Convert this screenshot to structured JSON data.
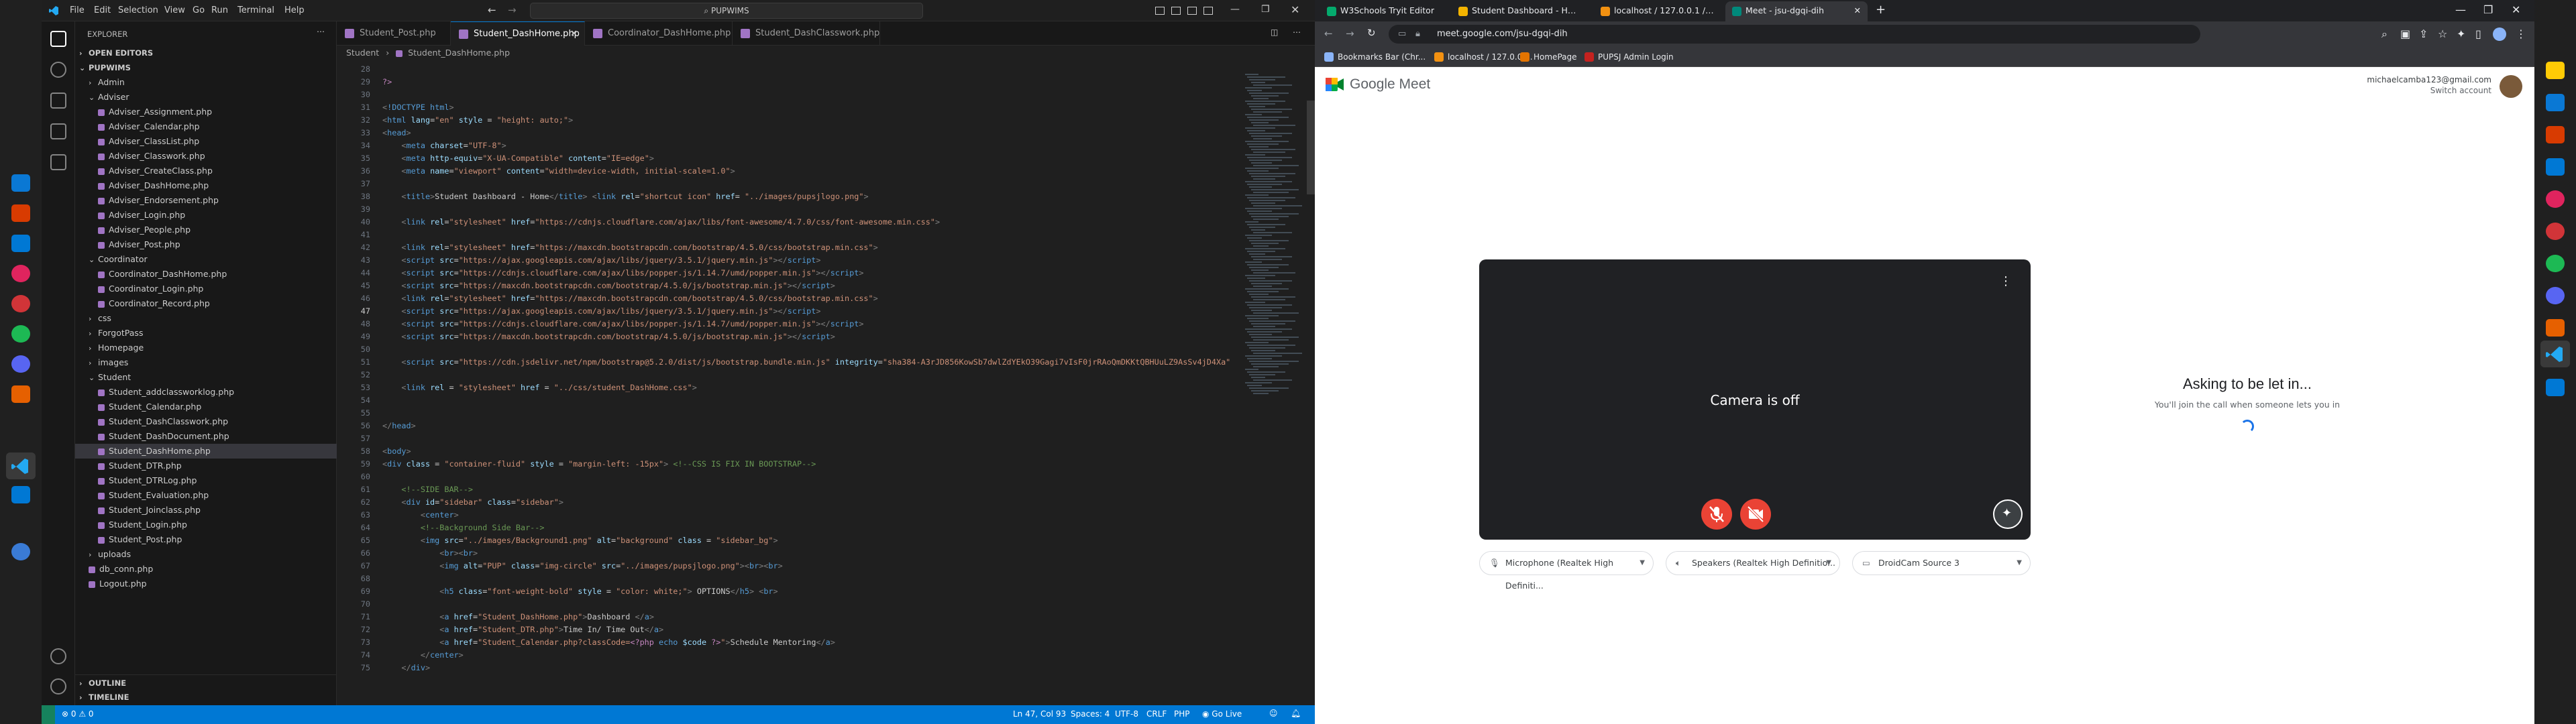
{
  "vscode": {
    "menu": [
      "File",
      "Edit",
      "Selection",
      "View",
      "Go",
      "Run",
      "Terminal",
      "Help"
    ],
    "search": "PUPWIMS",
    "explorer": {
      "title": "EXPLORER",
      "open_editors": "OPEN EDITORS",
      "root": "PUPWIMS",
      "items": [
        {
          "label": "Admin",
          "type": "folder",
          "depth": 1,
          "open": false
        },
        {
          "label": "Adviser",
          "type": "folder",
          "depth": 1,
          "open": true
        },
        {
          "label": "Adviser_Assignment.php",
          "type": "file",
          "depth": 2
        },
        {
          "label": "Adviser_Calendar.php",
          "type": "file",
          "depth": 2
        },
        {
          "label": "Adviser_ClassList.php",
          "type": "file",
          "depth": 2
        },
        {
          "label": "Adviser_Classwork.php",
          "type": "file",
          "depth": 2
        },
        {
          "label": "Adviser_CreateClass.php",
          "type": "file",
          "depth": 2
        },
        {
          "label": "Adviser_DashHome.php",
          "type": "file",
          "depth": 2
        },
        {
          "label": "Adviser_Endorsement.php",
          "type": "file",
          "depth": 2
        },
        {
          "label": "Adviser_Login.php",
          "type": "file",
          "depth": 2
        },
        {
          "label": "Adviser_People.php",
          "type": "file",
          "depth": 2
        },
        {
          "label": "Adviser_Post.php",
          "type": "file",
          "depth": 2
        },
        {
          "label": "Coordinator",
          "type": "folder",
          "depth": 1,
          "open": true
        },
        {
          "label": "Coordinator_DashHome.php",
          "type": "file",
          "depth": 2
        },
        {
          "label": "Coordinator_Login.php",
          "type": "file",
          "depth": 2
        },
        {
          "label": "Coordinator_Record.php",
          "type": "file",
          "depth": 2
        },
        {
          "label": "css",
          "type": "folder",
          "depth": 1,
          "open": false
        },
        {
          "label": "ForgotPass",
          "type": "folder",
          "depth": 1,
          "open": false
        },
        {
          "label": "Homepage",
          "type": "folder",
          "depth": 1,
          "open": false
        },
        {
          "label": "images",
          "type": "folder",
          "depth": 1,
          "open": false
        },
        {
          "label": "Student",
          "type": "folder",
          "depth": 1,
          "open": true
        },
        {
          "label": "Student_addclassworklog.php",
          "type": "file",
          "depth": 2
        },
        {
          "label": "Student_Calendar.php",
          "type": "file",
          "depth": 2
        },
        {
          "label": "Student_DashClasswork.php",
          "type": "file",
          "depth": 2
        },
        {
          "label": "Student_DashDocument.php",
          "type": "file",
          "depth": 2
        },
        {
          "label": "Student_DashHome.php",
          "type": "file",
          "depth": 2,
          "selected": true
        },
        {
          "label": "Student_DTR.php",
          "type": "file",
          "depth": 2
        },
        {
          "label": "Student_DTRLog.php",
          "type": "file",
          "depth": 2
        },
        {
          "label": "Student_Evaluation.php",
          "type": "file",
          "depth": 2
        },
        {
          "label": "Student_Joinclass.php",
          "type": "file",
          "depth": 2
        },
        {
          "label": "Student_Login.php",
          "type": "file",
          "depth": 2
        },
        {
          "label": "Student_Post.php",
          "type": "file",
          "depth": 2
        },
        {
          "label": "uploads",
          "type": "folder",
          "depth": 1,
          "open": false
        },
        {
          "label": "db_conn.php",
          "type": "file",
          "depth": 1
        },
        {
          "label": "Logout.php",
          "type": "file",
          "depth": 1
        }
      ],
      "outline": "OUTLINE",
      "timeline": "TIMELINE"
    },
    "tabs": [
      {
        "label": "Student_Post.php",
        "active": false
      },
      {
        "label": "Student_DashHome.php",
        "active": true
      },
      {
        "label": "Coordinator_DashHome.php",
        "active": false
      },
      {
        "label": "Student_DashClasswork.php",
        "active": false
      }
    ],
    "breadcrumb": [
      "Student",
      "Student_DashHome.php"
    ],
    "current_line": "47",
    "code_lines": [
      {
        "n": "28",
        "h": ""
      },
      {
        "n": "29",
        "h": "<span class='k'>?&gt;</span>"
      },
      {
        "n": "30",
        "h": ""
      },
      {
        "n": "31",
        "h": "<span class='p'>&lt;</span><span class='t'>!DOCTYPE html</span><span class='p'>&gt;</span>"
      },
      {
        "n": "32",
        "h": "<span class='p'>&lt;</span><span class='t'>html</span> <span class='a'>lang</span>=<span class='s'>\"en\"</span> <span class='a'>style</span> = <span class='s'>\"height: auto;\"</span><span class='p'>&gt;</span>"
      },
      {
        "n": "33",
        "h": "<span class='p'>&lt;</span><span class='t'>head</span><span class='p'>&gt;</span>"
      },
      {
        "n": "34",
        "h": "    <span class='p'>&lt;</span><span class='t'>meta</span> <span class='a'>charset</span>=<span class='s'>\"UTF-8\"</span><span class='p'>&gt;</span>"
      },
      {
        "n": "35",
        "h": "    <span class='p'>&lt;</span><span class='t'>meta</span> <span class='a'>http-equiv</span>=<span class='s'>\"X-UA-Compatible\"</span> <span class='a'>content</span>=<span class='s'>\"IE=edge\"</span><span class='p'>&gt;</span>"
      },
      {
        "n": "36",
        "h": "    <span class='p'>&lt;</span><span class='t'>meta</span> <span class='a'>name</span>=<span class='s'>\"viewport\"</span> <span class='a'>content</span>=<span class='s'>\"width=device-width, initial-scale=1.0\"</span><span class='p'>&gt;</span>"
      },
      {
        "n": "37",
        "h": ""
      },
      {
        "n": "38",
        "h": "    <span class='p'>&lt;</span><span class='t'>title</span><span class='p'>&gt;</span>Student Dashboard - Home<span class='p'>&lt;/</span><span class='t'>title</span><span class='p'>&gt;</span> <span class='p'>&lt;</span><span class='t'>link</span> <span class='a'>rel</span>=<span class='s'>\"shortcut icon\"</span> <span class='a'>href</span>= <span class='s'>\"../images/pupsjlogo.png\"</span><span class='p'>&gt;</span>"
      },
      {
        "n": "39",
        "h": ""
      },
      {
        "n": "40",
        "h": "    <span class='p'>&lt;</span><span class='t'>link</span> <span class='a'>rel</span>=<span class='s'>\"stylesheet\"</span> <span class='a'>href</span>=<span class='s'>\"https://cdnjs.cloudflare.com/ajax/libs/font-awesome/4.7.0/css/font-awesome.min.css\"</span><span class='p'>&gt;</span>"
      },
      {
        "n": "41",
        "h": ""
      },
      {
        "n": "42",
        "h": "    <span class='p'>&lt;</span><span class='t'>link</span> <span class='a'>rel</span>=<span class='s'>\"stylesheet\"</span> <span class='a'>href</span>=<span class='s'>\"https://maxcdn.bootstrapcdn.com/bootstrap/4.5.0/css/bootstrap.min.css\"</span><span class='p'>&gt;</span>"
      },
      {
        "n": "43",
        "h": "    <span class='p'>&lt;</span><span class='t'>script</span> <span class='a'>src</span>=<span class='s'>\"https://ajax.googleapis.com/ajax/libs/jquery/3.5.1/jquery.min.js\"</span><span class='p'>&gt;&lt;/</span><span class='t'>script</span><span class='p'>&gt;</span>"
      },
      {
        "n": "44",
        "h": "    <span class='p'>&lt;</span><span class='t'>script</span> <span class='a'>src</span>=<span class='s'>\"https://cdnjs.cloudflare.com/ajax/libs/popper.js/1.14.7/umd/popper.min.js\"</span><span class='p'>&gt;&lt;/</span><span class='t'>script</span><span class='p'>&gt;</span>"
      },
      {
        "n": "45",
        "h": "    <span class='p'>&lt;</span><span class='t'>script</span> <span class='a'>src</span>=<span class='s'>\"https://maxcdn.bootstrapcdn.com/bootstrap/4.5.0/js/bootstrap.min.js\"</span><span class='p'>&gt;&lt;/</span><span class='t'>script</span><span class='p'>&gt;</span>"
      },
      {
        "n": "46",
        "h": "    <span class='p'>&lt;</span><span class='t'>link</span> <span class='a'>rel</span>=<span class='s'>\"stylesheet\"</span> <span class='a'>href</span>=<span class='s'>\"https://maxcdn.bootstrapcdn.com/bootstrap/4.5.0/css/bootstrap.min.css\"</span><span class='p'>&gt;</span>"
      },
      {
        "n": "47",
        "h": "    <span class='p'>&lt;</span><span class='t'>script</span> <span class='a'>src</span>=<span class='s'>\"https://ajax.googleapis.com/ajax/libs/jquery/3.5.1/jquery.min.js\"</span><span class='p'>&gt;&lt;/</span><span class='t'>script</span><span class='p'>&gt;</span>"
      },
      {
        "n": "48",
        "h": "    <span class='p'>&lt;</span><span class='t'>script</span> <span class='a'>src</span>=<span class='s'>\"https://cdnjs.cloudflare.com/ajax/libs/popper.js/1.14.7/umd/popper.min.js\"</span><span class='p'>&gt;&lt;/</span><span class='t'>script</span><span class='p'>&gt;</span>"
      },
      {
        "n": "49",
        "h": "    <span class='p'>&lt;</span><span class='t'>script</span> <span class='a'>src</span>=<span class='s'>\"https://maxcdn.bootstrapcdn.com/bootstrap/4.5.0/js/bootstrap.min.js\"</span><span class='p'>&gt;&lt;/</span><span class='t'>script</span><span class='p'>&gt;</span>"
      },
      {
        "n": "50",
        "h": ""
      },
      {
        "n": "51",
        "h": "    <span class='p'>&lt;</span><span class='t'>script</span> <span class='a'>src</span>=<span class='s'>\"https://cdn.jsdelivr.net/npm/bootstrap@5.2.0/dist/js/bootstrap.bundle.min.js\"</span> <span class='a'>integrity</span>=<span class='s'>\"sha384-A3rJD856KowSb7dwlZdYEkO39Gagi7vIsF0jrRAoQmDKKtQBHUuLZ9AsSv4jD4Xa\"</span>"
      },
      {
        "n": "52",
        "h": ""
      },
      {
        "n": "53",
        "h": "    <span class='p'>&lt;</span><span class='t'>link</span> <span class='a'>rel</span> = <span class='s'>\"stylesheet\"</span> <span class='a'>href</span> = <span class='s'>\"../css/student_DashHome.css\"</span><span class='p'>&gt;</span>"
      },
      {
        "n": "54",
        "h": ""
      },
      {
        "n": "55",
        "h": ""
      },
      {
        "n": "56",
        "h": "<span class='p'>&lt;/</span><span class='t'>head</span><span class='p'>&gt;</span>"
      },
      {
        "n": "57",
        "h": ""
      },
      {
        "n": "58",
        "h": "<span class='p'>&lt;</span><span class='t'>body</span><span class='p'>&gt;</span>"
      },
      {
        "n": "59",
        "h": "<span class='p'>&lt;</span><span class='t'>div</span> <span class='a'>class</span> = <span class='s'>\"container-fluid\"</span> <span class='a'>style</span> = <span class='s'>\"margin-left: -15px\"</span><span class='p'>&gt;</span> <span class='c'>&lt;!--CSS IS FIX IN BOOTSTRAP--&gt;</span>"
      },
      {
        "n": "60",
        "h": ""
      },
      {
        "n": "61",
        "h": "    <span class='c'>&lt;!--SIDE BAR--&gt;</span>"
      },
      {
        "n": "62",
        "h": "    <span class='p'>&lt;</span><span class='t'>div</span> <span class='a'>id</span>=<span class='s'>\"sidebar\"</span> <span class='a'>class</span>=<span class='s'>\"sidebar\"</span><span class='p'>&gt;</span>"
      },
      {
        "n": "63",
        "h": "        <span class='p'>&lt;</span><span class='t'>center</span><span class='p'>&gt;</span>"
      },
      {
        "n": "64",
        "h": "        <span class='c'>&lt;!--Background Side Bar--&gt;</span>"
      },
      {
        "n": "65",
        "h": "        <span class='p'>&lt;</span><span class='t'>img</span> <span class='a'>src</span>=<span class='s'>\"../images/Background1.png\"</span> <span class='a'>alt</span>=<span class='s'>\"background\"</span> <span class='a'>class</span> = <span class='s'>\"sidebar_bg\"</span><span class='p'>&gt;</span>"
      },
      {
        "n": "66",
        "h": "            <span class='p'>&lt;</span><span class='t'>br</span><span class='p'>&gt;&lt;</span><span class='t'>br</span><span class='p'>&gt;</span>"
      },
      {
        "n": "67",
        "h": "            <span class='p'>&lt;</span><span class='t'>img</span> <span class='a'>alt</span>=<span class='s'>\"PUP\"</span> <span class='a'>class</span>=<span class='s'>\"img-circle\"</span> <span class='a'>src</span>=<span class='s'>\"../images/pupsjlogo.png\"</span><span class='p'>&gt;&lt;</span><span class='t'>br</span><span class='p'>&gt;&lt;</span><span class='t'>br</span><span class='p'>&gt;</span>"
      },
      {
        "n": "68",
        "h": ""
      },
      {
        "n": "69",
        "h": "            <span class='p'>&lt;</span><span class='t'>h5</span> <span class='a'>class</span>=<span class='s'>\"font-weight-bold\"</span> <span class='a'>style</span> = <span class='s'>\"color: white;\"</span><span class='p'>&gt;</span> OPTIONS<span class='p'>&lt;/</span><span class='t'>h5</span><span class='p'>&gt;</span> <span class='p'>&lt;</span><span class='t'>br</span><span class='p'>&gt;</span>"
      },
      {
        "n": "70",
        "h": ""
      },
      {
        "n": "71",
        "h": "            <span class='p'>&lt;</span><span class='t'>a</span> <span class='a'>href</span>=<span class='s'>\"Student_DashHome.php\"</span><span class='p'>&gt;</span>Dashboard <span class='p'>&lt;/</span><span class='t'>a</span><span class='p'>&gt;</span>"
      },
      {
        "n": "72",
        "h": "            <span class='p'>&lt;</span><span class='t'>a</span> <span class='a'>href</span>=<span class='s'>\"Student_DTR.php\"</span><span class='p'>&gt;</span>Time In/ Time Out<span class='p'>&lt;/</span><span class='t'>a</span><span class='p'>&gt;</span>"
      },
      {
        "n": "73",
        "h": "            <span class='p'>&lt;</span><span class='t'>a</span> <span class='a'>href</span>=<span class='s'>\"Student_Calendar.php?classCode=</span><span class='k'>&lt;?php</span> <span class='t'>echo</span> <span class='a'>$code</span> <span class='k'>?&gt;</span><span class='s'>\"</span><span class='p'>&gt;</span>Schedule Mentoring<span class='p'>&lt;/</span><span class='t'>a</span><span class='p'>&gt;</span>"
      },
      {
        "n": "74",
        "h": "        <span class='p'>&lt;/</span><span class='t'>center</span><span class='p'>&gt;</span>"
      },
      {
        "n": "75",
        "h": "    <span class='p'>&lt;/</span><span class='t'>div</span><span class='p'>&gt;</span>"
      }
    ],
    "status": {
      "left": "⊗ 0 ⚠ 0",
      "position": "Ln 47, Col 93",
      "spaces": "Spaces: 4",
      "encoding": "UTF-8",
      "eol": "CRLF",
      "language": "PHP",
      "golive": "Go Live"
    }
  },
  "chrome": {
    "tabs": [
      {
        "label": "W3Schools Tryit Editor",
        "active": false,
        "color": "#04aa6d"
      },
      {
        "label": "Student Dashboard - Home",
        "active": false,
        "color": "#f4b400"
      },
      {
        "label": "localhost / 127.0.0.1 / db_p",
        "active": false,
        "color": "#f29111"
      },
      {
        "label": "Meet - jsu-dgqi-dih",
        "active": true,
        "color": "#00897b"
      }
    ],
    "url": "meet.google.com/jsu-dgqi-dih",
    "bookmarks": [
      {
        "label": "Bookmarks Bar (Chr...",
        "color": "#8ab4f8"
      },
      {
        "label": "localhost / 127.0.0....",
        "color": "#f29111"
      },
      {
        "label": "HomePage",
        "color": "#e37400"
      },
      {
        "label": "PUPSJ Admin Login",
        "color": "#c5221f"
      }
    ]
  },
  "meet": {
    "logo": "Google Meet",
    "account_email": "michaelcamba123@gmail.com",
    "switch_account": "Switch account",
    "camera_off": "Camera is off",
    "asking_title": "Asking to be let in...",
    "asking_sub": "You'll join the call when someone lets you in",
    "devices": {
      "microphone": "Microphone (Realtek High Definiti...",
      "speakers": "Speakers (Realtek High Definitio...",
      "camera": "DroidCam Source 3"
    }
  }
}
